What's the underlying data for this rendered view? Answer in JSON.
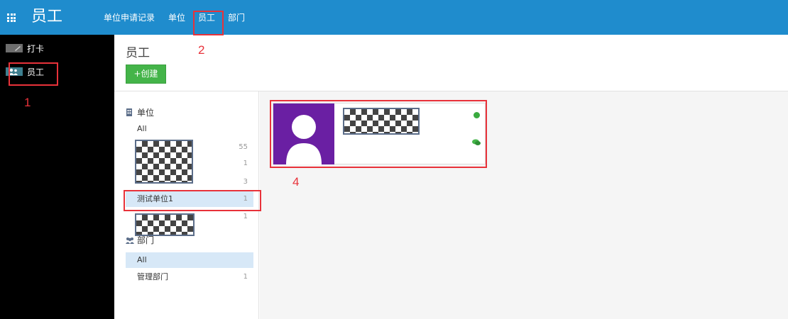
{
  "app": {
    "title": "员工"
  },
  "nav": {
    "items": [
      "单位申请记录",
      "单位",
      "员工",
      "部门"
    ]
  },
  "sidebar": {
    "items": [
      {
        "label": "打卡"
      },
      {
        "label": "员工"
      }
    ]
  },
  "page": {
    "title": "员工",
    "create_label": "+创建"
  },
  "filters": {
    "unit": {
      "heading": "单位",
      "rows": [
        {
          "label": "All",
          "count": ""
        },
        {
          "label": "",
          "count": "55"
        },
        {
          "label": "",
          "count": "1"
        },
        {
          "label": "",
          "count": "3"
        },
        {
          "label": "测试单位1",
          "count": "1"
        },
        {
          "label": "",
          "count": "1"
        }
      ]
    },
    "dept": {
      "heading": "部门",
      "rows": [
        {
          "label": "All",
          "count": ""
        },
        {
          "label": "管理部门",
          "count": "1"
        }
      ]
    }
  },
  "annotations": [
    "1",
    "2",
    "4"
  ],
  "colors": {
    "topbar": "#1f8ccd",
    "sidebar": "#000000",
    "create": "#44b449",
    "avatar_bg": "#6a1fa3",
    "highlight": "#e8323a"
  }
}
